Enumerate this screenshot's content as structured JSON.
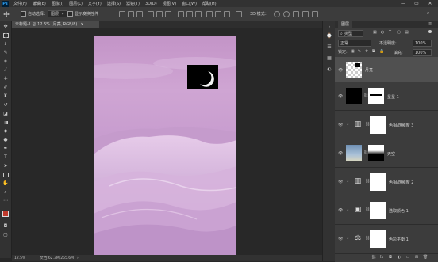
{
  "menubar": {
    "logo": "Ps",
    "items": [
      "文件(F)",
      "编辑(E)",
      "图像(I)",
      "图层(L)",
      "文字(Y)",
      "选择(S)",
      "滤镜(T)",
      "3D(D)",
      "视图(V)",
      "窗口(W)",
      "帮助(H)"
    ],
    "minimize": "—",
    "restore": "▭",
    "close": "✕"
  },
  "options": {
    "auto_select_label": "自动选择：",
    "auto_select_value": "图层",
    "show_transform_label": "显示变换控件",
    "mode_label": "3D 模式："
  },
  "document": {
    "tab_title": "未标题-1 @ 12.5% (月亮, RGB/8)",
    "tab_close": "×",
    "zoom": "12.5%",
    "doc_info": "文档:62.3M/255.6M"
  },
  "layers_panel": {
    "tab_label": "图层",
    "filter_kind": "类型",
    "blend_mode": "正常",
    "opacity_label": "不透明度:",
    "opacity_value": "100%",
    "lock_label": "锁定:",
    "fill_label": "填充:",
    "fill_value": "100%",
    "layers": [
      {
        "name": "月亮",
        "type": "pixel"
      },
      {
        "name": "星星 1",
        "type": "mask"
      },
      {
        "name": "色相/饱和度 3",
        "type": "adjustment"
      },
      {
        "name": "天空",
        "type": "masked-image"
      },
      {
        "name": "色相/饱和度 2",
        "type": "adjustment"
      },
      {
        "name": "选取颜色 1",
        "type": "adjustment"
      },
      {
        "name": "色彩平衡 1",
        "type": "adjustment"
      }
    ]
  },
  "icons": {
    "toolbar": [
      "move-icon",
      "marquee-icon",
      "lasso-icon",
      "quick-select-icon",
      "crop-icon",
      "eyedropper-icon",
      "healing-icon",
      "brush-icon",
      "stamp-icon",
      "history-brush-icon",
      "eraser-icon",
      "gradient-icon",
      "blur-icon",
      "dodge-icon",
      "pen-icon",
      "type-icon",
      "path-select-icon",
      "shape-icon",
      "hand-icon",
      "zoom-icon"
    ]
  },
  "colors": {
    "accent": "#31a8ff",
    "artboard_top": "#c79ac9",
    "foreground_color": "#c0392b",
    "background_color": "#000000"
  }
}
